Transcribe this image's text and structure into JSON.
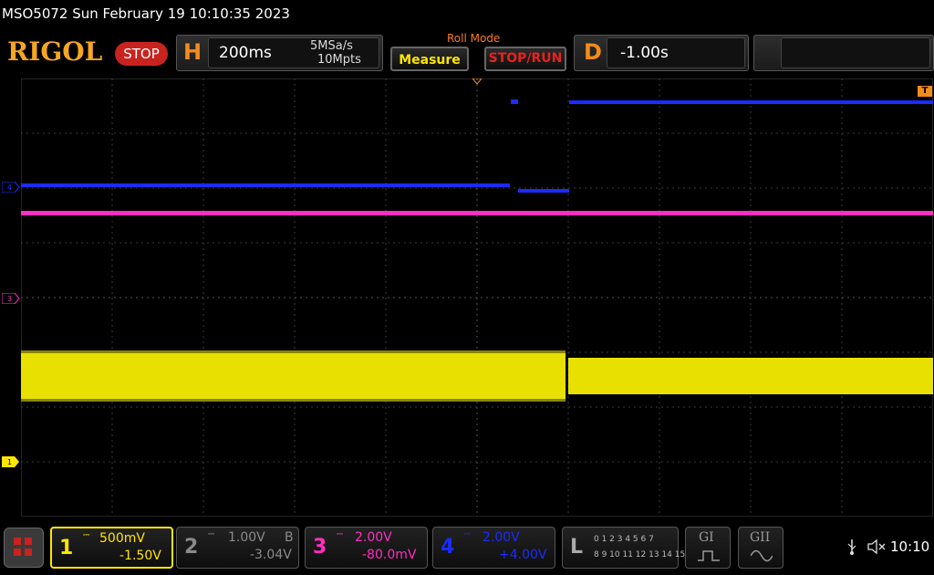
{
  "title": "MSO5072  Sun February 19 10:10:35 2023",
  "logo": "RIGOL",
  "run_state": "STOP",
  "horizontal": {
    "letter": "H",
    "timebase": "200ms",
    "sample_rate": "5MSa/s",
    "memory_depth": "10Mpts"
  },
  "mode_label": "Roll Mode",
  "buttons": {
    "measure": "Measure",
    "stop_run": "STOP/RUN"
  },
  "delay": {
    "letter": "D",
    "value": "-1.00s"
  },
  "trigger_marker": "T",
  "channels": [
    {
      "num": "1",
      "scale": "500mV",
      "offset": "-1.50V",
      "color": "#ffe600",
      "active": true
    },
    {
      "num": "2",
      "scale": "1.00V",
      "flag": "B",
      "offset": "-3.04V",
      "color": "#8a8a8a",
      "active": false
    },
    {
      "num": "3",
      "scale": "2.00V",
      "offset": "-80.0mV",
      "color": "#ff2fbf",
      "active": true
    },
    {
      "num": "4",
      "scale": "2.00V",
      "offset": "+4.00V",
      "color": "#1a2cff",
      "active": true
    }
  ],
  "logic": {
    "letter": "L",
    "row1": "0 1 2 3  4 5 6 7",
    "row2": "8 9 10 11 12 13 14 15"
  },
  "generators": [
    {
      "label": "GI"
    },
    {
      "label": "GII"
    }
  ],
  "status": {
    "time": "10:10",
    "usb": "usb-icon",
    "sound": "speaker-muted-icon"
  },
  "colors": {
    "ch1": "#ffe600",
    "ch3": "#ff2fbf",
    "ch4": "#1a2cff",
    "accent": "#f28c1b"
  }
}
